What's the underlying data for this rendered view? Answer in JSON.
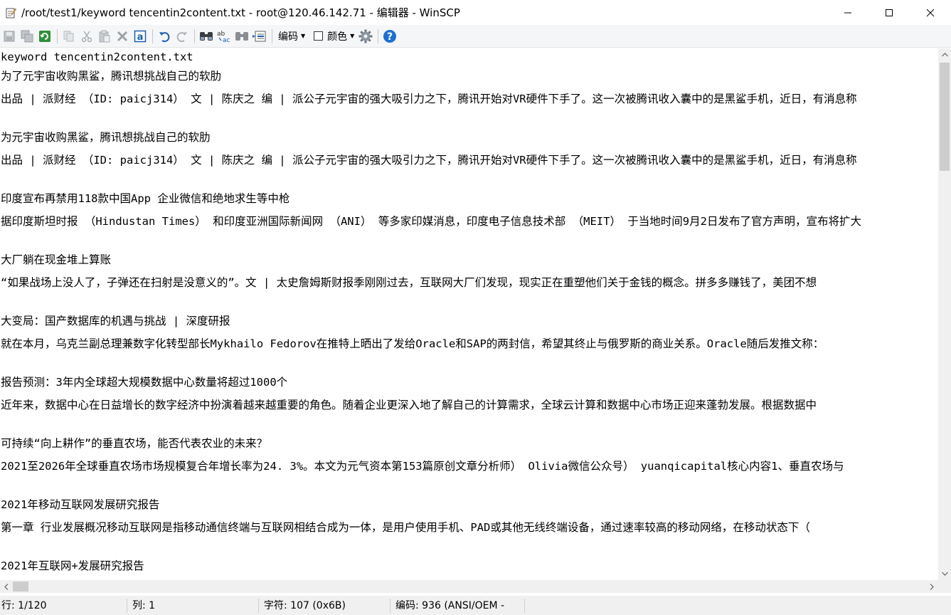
{
  "window": {
    "title": "/root/test1/keyword tencentin2content.txt - root@120.46.142.71 - 编辑器 - WinSCP"
  },
  "toolbar": {
    "encoding_label": "编码",
    "color_label": "颜色",
    "icons": [
      "save-icon",
      "save-all-icon",
      "reload-icon",
      "copy-icon",
      "cut-icon",
      "paste-icon",
      "delete-icon",
      "select-all-icon",
      "undo-icon",
      "redo-icon",
      "find-icon",
      "replace-icon",
      "find-next-icon",
      "goto-line-icon",
      "settings-icon",
      "help-icon"
    ]
  },
  "editor": {
    "lines": [
      "keyword tencentin2content.txt",
      "为了元宇宙收购黑鲨，腾讯想挑战自己的软肋",
      "出品 | 派财经 （ID: paicj314） 文 | 陈庆之 编 | 派公子元宇宙的强大吸引力之下，腾讯开始对VR硬件下手了。这一次被腾讯收入囊中的是黑鲨手机，近日，有消息称",
      "",
      "为元宇宙收购黑鲨，腾讯想挑战自己的软肋",
      "出品 | 派财经 （ID: paicj314） 文 | 陈庆之 编 | 派公子元宇宙的强大吸引力之下，腾讯开始对VR硬件下手了。这一次被腾讯收入囊中的是黑鲨手机，近日，有消息称",
      "",
      "印度宣布再禁用118款中国App 企业微信和绝地求生等中枪",
      "据印度斯坦时报 （Hindustan Times） 和印度亚洲国际新闻网 （ANI） 等多家印媒消息，印度电子信息技术部 （MEIT） 于当地时间9月2日发布了官方声明，宣布将扩大",
      "",
      "大厂躺在现金堆上算账",
      "“如果战场上没人了，子弹还在扫射是没意义的”。文 | 太史詹姆斯财报季刚刚过去，互联网大厂们发现，现实正在重塑他们关于金钱的概念。拼多多赚钱了，美团不想",
      "",
      "大变局：国产数据库的机遇与挑战 | 深度研报",
      "就在本月，乌克兰副总理兼数字化转型部长Mykhailo Fedorov在推特上晒出了发给Oracle和SAP的两封信，希望其终止与俄罗斯的商业关系。Oracle随后发推文称：",
      "",
      "报告预测：3年内全球超大规模数据中心数量将超过1000个",
      "近年来，数据中心在日益增长的数字经济中扮演着越来越重要的角色。随着企业更深入地了解自己的计算需求，全球云计算和数据中心市场正迎来蓬勃发展。根据数据中",
      "",
      "可持续“向上耕作”的垂直农场，能否代表农业的未来？",
      "2021至2026年全球垂直农场市场规模复合年增长率为24. 3%。本文为元气资本第153篇原创文章分析师） Olivia微信公众号） yuanqicapital核心内容1、垂直农场与",
      "",
      "2021年移动互联网发展研究报告",
      "第一章 行业发展概况移动互联网是指移动通信终端与互联网相结合成为一体，是用户使用手机、PAD或其他无线终端设备，通过速率较高的移动网络，在移动状态下（",
      "",
      "2021年互联网+发展研究报告"
    ]
  },
  "statusbar": {
    "line": "行: 1/120",
    "column": "列: 1",
    "character": "字符: 107 (0x6B)",
    "encoding": "编码: 936  (ANSI/OEM -"
  }
}
